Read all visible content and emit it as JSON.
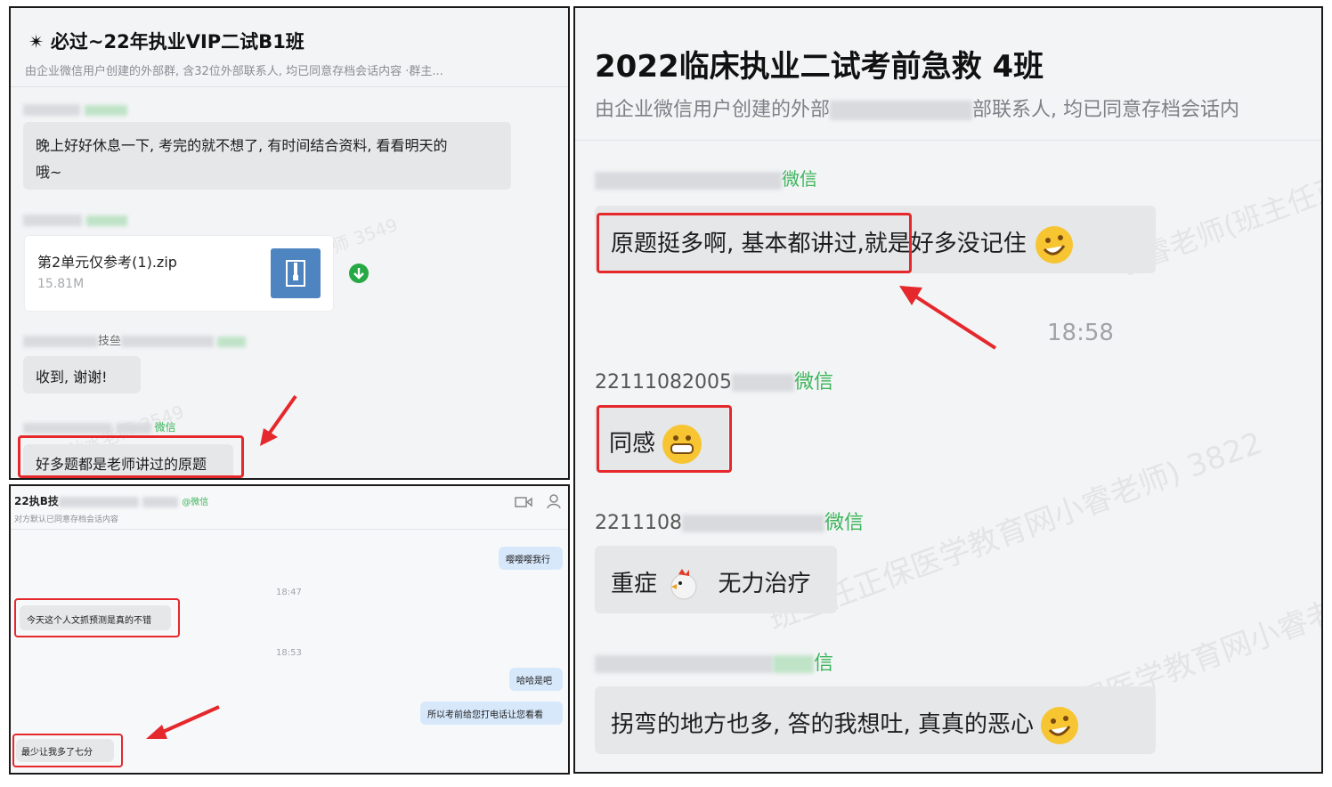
{
  "panel_a": {
    "title": "✴ 必过~22年执业VIP二试B1班",
    "subtitle": "由企业微信用户创建的外部群, 含32位外部联系人, 均已同意存档会话内容 ·群主...",
    "msg1": "晚上好好休息一下, 考完的就不想了, 有时间结合资料, 看看明天的",
    "msg1_line2": "哦~",
    "file_name": "第2单元仅参考(1).zip",
    "file_size": "15.81M",
    "sender3_partial": "技亝",
    "msg3": "收到, 谢谢!",
    "wechat_tag": "微信",
    "msg4": "好多题都是老师讲过的原题",
    "watermark": "秋水老师 3549"
  },
  "panel_b": {
    "title": "22执B技",
    "subtitle": "对方默认已同意存档会话内容",
    "tag": "@微信",
    "me1": "嘤嘤嘤我行",
    "time1": "18:47",
    "other1": "今天这个人文抓预测是真的不错",
    "time2": "18:53",
    "me2": "哈哈是吧",
    "me3": "所以考前给您打电话让您看看",
    "other2": "最少让我多了七分"
  },
  "panel_c": {
    "title": "2022临床执业二试考前急救 4班",
    "subtitle_left": "由企业微信用户创建的外部",
    "subtitle_right": "部联系人, 均已同意存档会话内",
    "wechat_tag": "微信",
    "msg1_boxed": "原题挺多啊, 基本都讲过,",
    "msg1_rest": "就是好多没记住",
    "time": "18:58",
    "sender2_prefix": "22111082005",
    "msg2": "同感",
    "sender3_prefix": "2211108",
    "msg3_a": "重症",
    "msg3_b": "无力治疗",
    "tag4": "信",
    "msg4": "拐弯的地方也多, 答的我想吐, 真真的恶心",
    "watermark1": "小睿老师(班主任正",
    "watermark2": "班主任正保医学教育网小睿老师) 3822"
  },
  "colors": {
    "highlight": "#e5282c",
    "wechat_green": "#3bb559",
    "arrow": "#e5282c"
  }
}
